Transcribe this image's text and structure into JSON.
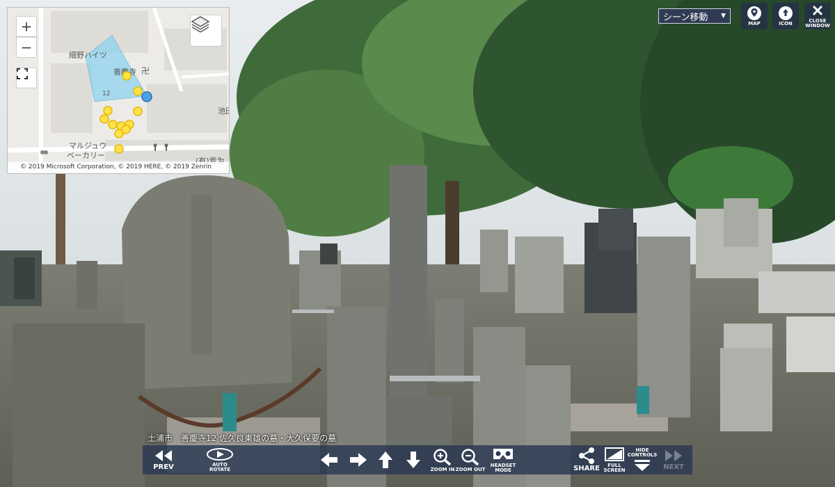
{
  "minimap": {
    "zoom_in_label": "+",
    "zoom_out_label": "−",
    "labels": {
      "hosono_heights": "細野ハイツ",
      "zenkyoji": "善慶寺",
      "number_12": "12",
      "ikeda": "池田",
      "marujuu": "マルジュウ",
      "bakery": "ベーカリー",
      "arakawa": "(有)荒为"
    },
    "copyright": "© 2019 Microsoft Corporation, © 2019 HERE, © 2019 Zenrin"
  },
  "top_controls": {
    "scene_select": "シーン移動",
    "map_label": "MAP",
    "icon_label": "ICON",
    "close_label_1": "CLOSE",
    "close_label_2": "WINDOW"
  },
  "caption": "土浦市　善慶寺12 佐久良東雄の墓・大久保要の墓",
  "toolbar": {
    "prev": "PREV",
    "auto_rotate_1": "AUTO",
    "auto_rotate_2": "ROTATE",
    "zoom_in": "ZOOM IN",
    "zoom_out": "ZOOM OUT",
    "headset_1": "HEADSET",
    "headset_2": "MODE",
    "share": "SHARE",
    "full_screen_1": "FULL",
    "full_screen_2": "SCREEN",
    "hide_controls_1": "HIDE",
    "hide_controls_2": "CONTROLS",
    "next": "NEXT"
  },
  "colors": {
    "toolbar_bg": "#2a3852",
    "map_marker": "#ffe14a",
    "map_current": "#4ba3e6",
    "map_view_cone": "#8fd3f0"
  }
}
